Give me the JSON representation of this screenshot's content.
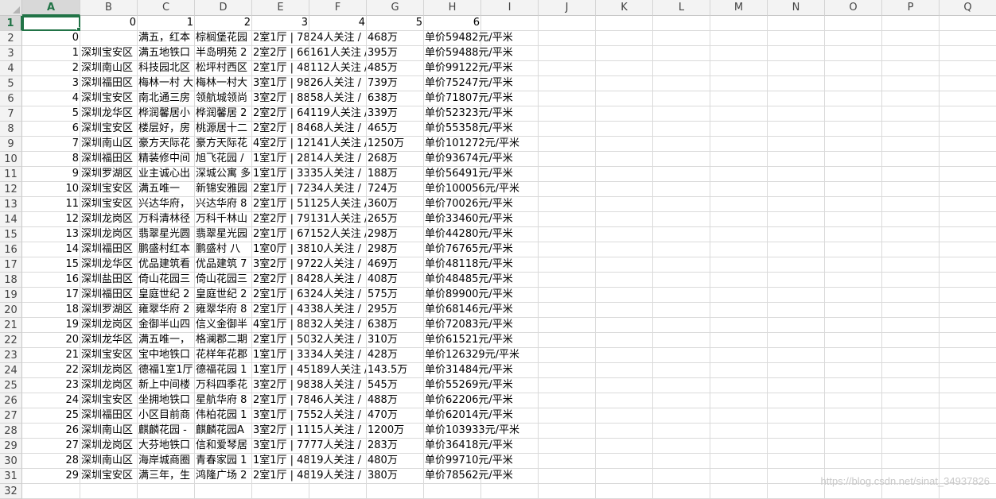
{
  "columns": [
    "A",
    "B",
    "C",
    "D",
    "E",
    "F",
    "G",
    "H",
    "I",
    "J",
    "K",
    "L",
    "M",
    "N",
    "O",
    "P",
    "Q"
  ],
  "header_row": [
    "",
    "0",
    "1",
    "2",
    "3",
    "4",
    "5",
    "6"
  ],
  "rows": [
    [
      "0",
      "",
      "满五，红本",
      "棕榈堡花园",
      "2室1厅 | 78",
      "24人关注 /",
      "468万",
      "单价59482元/平米"
    ],
    [
      "1",
      "深圳宝安区",
      "满五地铁口",
      "半岛明苑 2",
      "2室2厅 | 66",
      "161人关注 /",
      "395万",
      "单价59488元/平米"
    ],
    [
      "2",
      "深圳南山区",
      "科技园北区",
      "松坪村西区",
      "2室1厅 | 48",
      "112人关注 /",
      "485万",
      "单价99122元/平米"
    ],
    [
      "3",
      "深圳福田区",
      "梅林一村 大",
      "梅林一村大",
      "3室1厅 | 98",
      "26人关注 /",
      "739万",
      "单价75247元/平米"
    ],
    [
      "4",
      "深圳宝安区",
      "南北通三房",
      "领航城领尚",
      "3室2厅 | 88",
      "58人关注 /",
      "638万",
      "单价71807元/平米"
    ],
    [
      "5",
      "深圳龙华区",
      "桦润馨居小",
      "桦润馨居 2",
      "2室2厅 | 64",
      "119人关注 /",
      "339万",
      "单价52323元/平米"
    ],
    [
      "6",
      "深圳宝安区",
      "楼层好，房",
      "桃源居十二",
      "2室2厅 | 84",
      "68人关注 /",
      "465万",
      "单价55358元/平米"
    ],
    [
      "7",
      "深圳南山区",
      "豪方天际花",
      "豪方天际花",
      "4室2厅 | 12",
      "141人关注 /",
      "1250万",
      "单价101272元/平米"
    ],
    [
      "8",
      "深圳福田区",
      "精装修中间",
      "旭飞花园 /",
      "1室1厅 | 28",
      "14人关注 /",
      "268万",
      "单价93674元/平米"
    ],
    [
      "9",
      "深圳罗湖区",
      "业主诚心出",
      "深城公寓 多",
      "1室1厅 | 33",
      "35人关注 /",
      "188万",
      "单价56491元/平米"
    ],
    [
      "10",
      "深圳宝安区",
      "满五唯一",
      "新锦安雅园",
      "2室1厅 | 72",
      "34人关注 /",
      "724万",
      "单价100056元/平米"
    ],
    [
      "11",
      "深圳宝安区",
      "兴达华府，",
      "兴达华府 8",
      "2室1厅 | 51",
      "125人关注 /",
      "360万",
      "单价70026元/平米"
    ],
    [
      "12",
      "深圳龙岗区",
      "万科清林径",
      "万科千林山",
      "2室2厅 | 79",
      "131人关注 /",
      "265万",
      "单价33460元/平米"
    ],
    [
      "13",
      "深圳龙岗区",
      "翡翠星光圆",
      "翡翠星光园",
      "2室1厅 | 67",
      "152人关注 /",
      "298万",
      "单价44280元/平米"
    ],
    [
      "14",
      "深圳福田区",
      "鹏盛村红本",
      "鹏盛村 八",
      "1室0厅 | 38",
      "10人关注 /",
      "298万",
      "单价76765元/平米"
    ],
    [
      "15",
      "深圳龙华区",
      "优品建筑看",
      "优品建筑 7",
      "3室2厅 | 97",
      "22人关注 /",
      "469万",
      "单价48118元/平米"
    ],
    [
      "16",
      "深圳盐田区",
      "倚山花园三",
      "倚山花园三",
      "2室2厅 | 84",
      "28人关注 /",
      "408万",
      "单价48485元/平米"
    ],
    [
      "17",
      "深圳福田区",
      "皇庭世纪 2",
      "皇庭世纪 2",
      "2室1厅 | 63",
      "24人关注 /",
      "575万",
      "单价89900元/平米"
    ],
    [
      "18",
      "深圳罗湖区",
      "雍翠华府 2",
      "雍翠华府 8",
      "2室1厅 | 43",
      "38人关注 /",
      "295万",
      "单价68146元/平米"
    ],
    [
      "19",
      "深圳龙岗区",
      "金御半山四",
      "信义金御半",
      "4室1厅 | 88",
      "32人关注 /",
      "638万",
      "单价72083元/平米"
    ],
    [
      "20",
      "深圳龙华区",
      "满五唯一，",
      "格澜郡二期",
      "2室1厅 | 50",
      "32人关注 /",
      "310万",
      "单价61521元/平米"
    ],
    [
      "21",
      "深圳宝安区",
      "宝中地铁口",
      "花样年花郡",
      "1室1厅 | 33",
      "34人关注 /",
      "428万",
      "单价126329元/平米"
    ],
    [
      "22",
      "深圳龙岗区",
      "德福1室1厅",
      "德福花园 1",
      "1室1厅 | 45",
      "189人关注 /",
      "143.5万",
      "单价31484元/平米"
    ],
    [
      "23",
      "深圳龙岗区",
      "新上中间楼",
      "万科四季花",
      "3室2厅 | 98",
      "38人关注 /",
      "545万",
      "单价55269元/平米"
    ],
    [
      "24",
      "深圳宝安区",
      "坐拥地铁口",
      "星航华府 8",
      "2室1厅 | 78",
      "46人关注 /",
      "488万",
      "单价62206元/平米"
    ],
    [
      "25",
      "深圳福田区",
      "小区目前商",
      "伟柏花园 1",
      "3室1厅 | 75",
      "52人关注 /",
      "470万",
      "单价62014元/平米"
    ],
    [
      "26",
      "深圳南山区",
      "麒麟花园 -",
      "麒麟花园A",
      "3室2厅 | 11",
      "15人关注 /",
      "1200万",
      "单价103933元/平米"
    ],
    [
      "27",
      "深圳龙岗区",
      "大芬地铁口",
      "信和爱琴居",
      "3室1厅 | 77",
      "77人关注 /",
      "283万",
      "单价36418元/平米"
    ],
    [
      "28",
      "深圳南山区",
      "海岸城商圈",
      "青春家园 1",
      "1室1厅 | 48",
      "19人关注 /",
      "480万",
      "单价99710元/平米"
    ],
    [
      "29",
      "深圳宝安区",
      "满三年，生",
      "鸿隆广场 2",
      "2室1厅 | 48",
      "19人关注 /",
      "380万",
      "单价78562元/平米"
    ]
  ],
  "row_numbers": [
    "1",
    "2",
    "3",
    "4",
    "5",
    "6",
    "7",
    "8",
    "9",
    "10",
    "11",
    "12",
    "13",
    "14",
    "15",
    "16",
    "17",
    "18",
    "19",
    "20",
    "21",
    "22",
    "23",
    "24",
    "25",
    "26",
    "27",
    "28",
    "29",
    "30",
    "31",
    "32"
  ],
  "watermark": "https://blog.csdn.net/sinat_34937826"
}
